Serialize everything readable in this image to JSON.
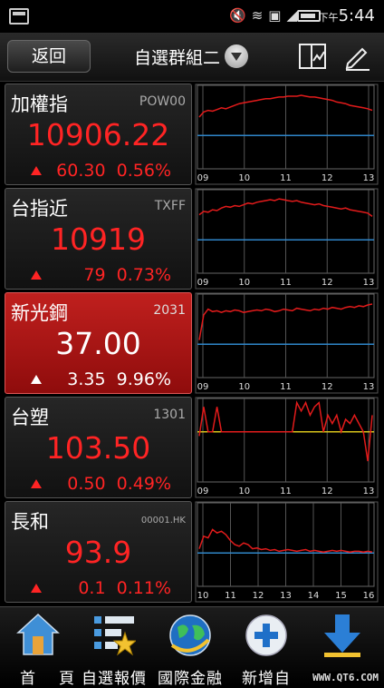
{
  "status_bar": {
    "time_prefix": "下午",
    "time": "5:44"
  },
  "header": {
    "back_label": "返回",
    "group_title": "自選群組二"
  },
  "stocks": [
    {
      "name": "加權指",
      "code": "POW00",
      "price": "10906.22",
      "change": "60.30",
      "percent": "0.56%",
      "selected": false,
      "chart": {
        "x_ticks": [
          "09",
          "10",
          "11",
          "12",
          "13"
        ],
        "line_color": "#e21b1b",
        "ref_color": "#2f86c9",
        "series": [
          0.62,
          0.68,
          0.7,
          0.69,
          0.71,
          0.73,
          0.72,
          0.74,
          0.76,
          0.78,
          0.79,
          0.8,
          0.81,
          0.82,
          0.83,
          0.84,
          0.84,
          0.85,
          0.86,
          0.86,
          0.87,
          0.87,
          0.87,
          0.88,
          0.87,
          0.86,
          0.86,
          0.85,
          0.84,
          0.83,
          0.82,
          0.8,
          0.79,
          0.78,
          0.76,
          0.75,
          0.74,
          0.73,
          0.72,
          0.7
        ],
        "ref": 0.4
      }
    },
    {
      "name": "台指近",
      "code": "TXFF",
      "price": "10919",
      "change": "79",
      "percent": "0.73%",
      "selected": false,
      "chart": {
        "x_ticks": [
          "09",
          "10",
          "11",
          "12",
          "13"
        ],
        "line_color": "#e21b1b",
        "ref_color": "#2f86c9",
        "series": [
          0.7,
          0.74,
          0.73,
          0.76,
          0.75,
          0.78,
          0.8,
          0.79,
          0.81,
          0.8,
          0.82,
          0.84,
          0.83,
          0.85,
          0.86,
          0.87,
          0.88,
          0.87,
          0.89,
          0.88,
          0.87,
          0.86,
          0.87,
          0.85,
          0.84,
          0.83,
          0.82,
          0.83,
          0.81,
          0.8,
          0.79,
          0.78,
          0.77,
          0.78,
          0.76,
          0.75,
          0.74,
          0.73,
          0.72,
          0.68
        ],
        "ref": 0.4
      }
    },
    {
      "name": "新光鋼",
      "code": "2031",
      "price": "37.00",
      "change": "3.35",
      "percent": "9.96%",
      "selected": true,
      "chart": {
        "x_ticks": [
          "09",
          "10",
          "11",
          "12",
          "13"
        ],
        "line_color": "#e21b1b",
        "ref_color": "#2f86c9",
        "series": [
          0.45,
          0.75,
          0.82,
          0.79,
          0.8,
          0.78,
          0.8,
          0.79,
          0.81,
          0.8,
          0.78,
          0.79,
          0.8,
          0.81,
          0.8,
          0.82,
          0.81,
          0.79,
          0.8,
          0.82,
          0.81,
          0.8,
          0.83,
          0.82,
          0.81,
          0.8,
          0.82,
          0.81,
          0.83,
          0.82,
          0.84,
          0.83,
          0.82,
          0.84,
          0.85,
          0.84,
          0.86,
          0.85,
          0.87,
          0.88
        ],
        "ref": 0.4
      }
    },
    {
      "name": "台塑",
      "code": "1301",
      "price": "103.50",
      "change": "0.50",
      "percent": "0.49%",
      "selected": false,
      "chart": {
        "x_ticks": [
          "09",
          "10",
          "11",
          "12",
          "13"
        ],
        "line_color": "#e21b1b",
        "ref_color": "#d6c21a",
        "series": [
          0.55,
          0.9,
          0.6,
          0.6,
          0.9,
          0.6,
          0.6,
          0.6,
          0.6,
          0.6,
          0.6,
          0.6,
          0.6,
          0.6,
          0.6,
          0.6,
          0.6,
          0.6,
          0.6,
          0.6,
          0.6,
          0.6,
          0.95,
          0.85,
          0.95,
          0.8,
          0.9,
          0.95,
          0.6,
          0.8,
          0.7,
          0.8,
          0.6,
          0.75,
          0.7,
          0.8,
          0.7,
          0.6,
          0.25,
          0.8
        ],
        "ref": 0.6
      }
    },
    {
      "name": "長和",
      "code": "00001.HK",
      "price": "93.9",
      "change": "0.1",
      "percent": "0.11%",
      "selected": false,
      "chart": {
        "x_ticks": [
          "10",
          "11",
          "12",
          "13",
          "14",
          "15",
          "16"
        ],
        "line_color": "#e21b1b",
        "ref_color": "#2f86c9",
        "series": [
          0.45,
          0.6,
          0.58,
          0.68,
          0.64,
          0.66,
          0.62,
          0.55,
          0.5,
          0.48,
          0.52,
          0.5,
          0.45,
          0.46,
          0.44,
          0.45,
          0.43,
          0.44,
          0.42,
          0.43,
          0.44,
          0.43,
          0.42,
          0.43,
          0.44,
          0.42,
          0.43,
          0.42,
          0.41,
          0.42,
          0.43,
          0.42,
          0.43,
          0.42,
          0.41,
          0.42,
          0.42,
          0.41,
          0.42,
          0.41
        ],
        "ref": 0.4
      }
    }
  ],
  "dock": {
    "home_label": "首頁",
    "watchlist_label": "自選報價",
    "intl_label": "國際金融",
    "add_label": "新增自",
    "download_label": ""
  },
  "watermark": "WWW.QT6.COM"
}
